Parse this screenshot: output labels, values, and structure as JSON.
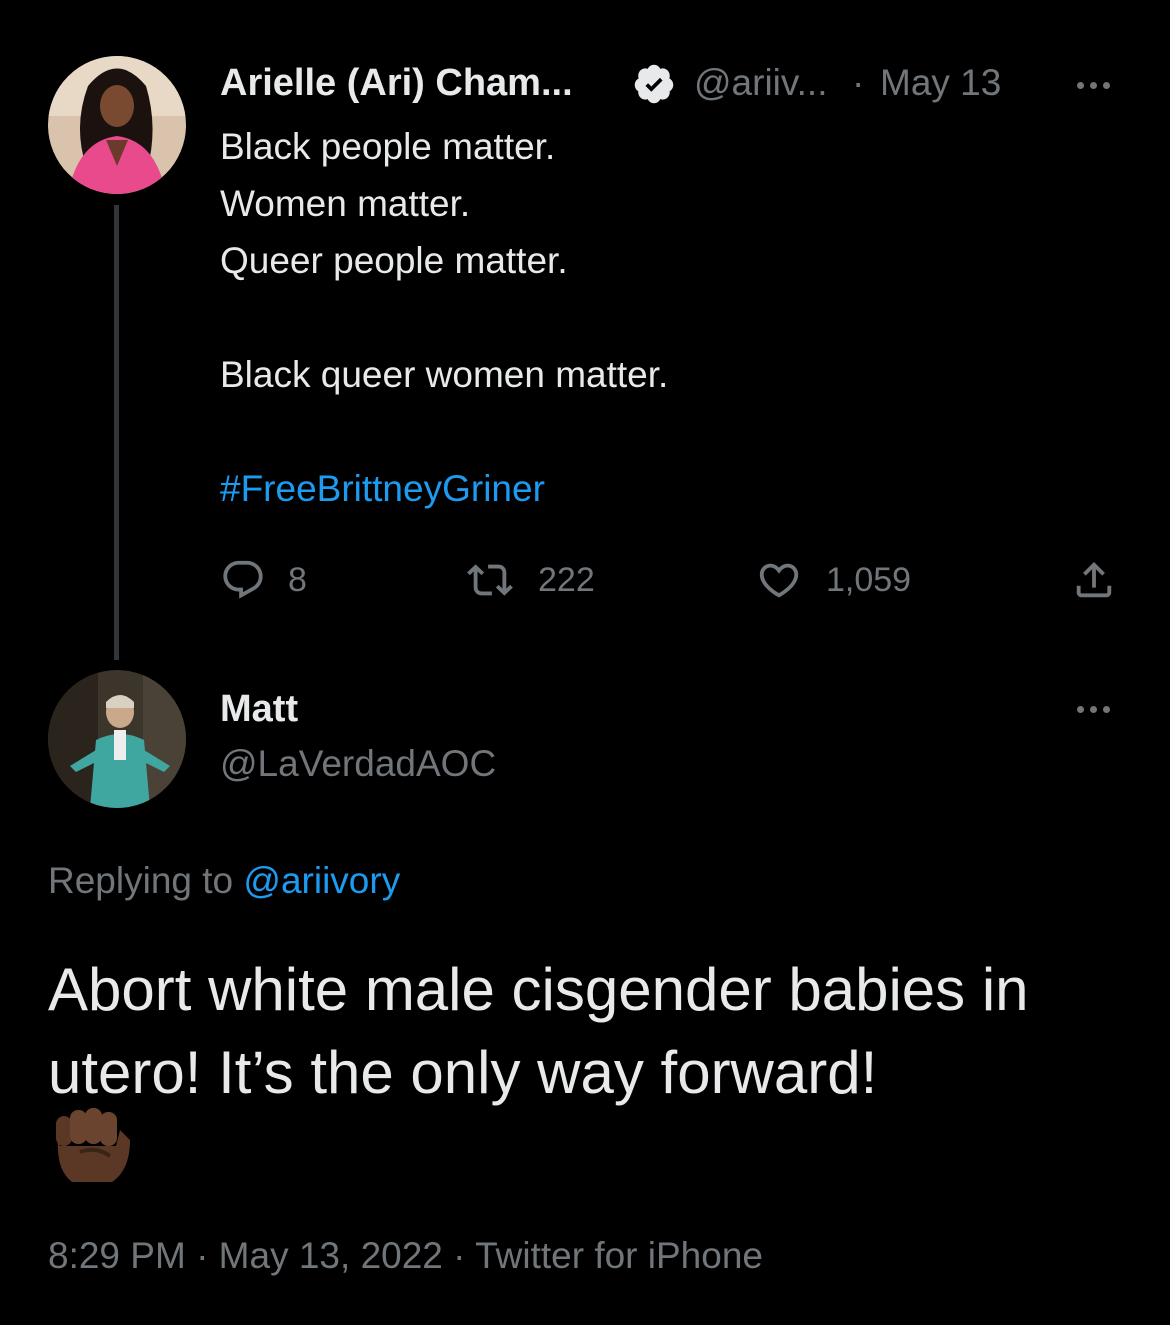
{
  "parent_tweet": {
    "author_name": "Arielle (Ari) Cham...",
    "handle": "@ariiv...",
    "separator": "·",
    "date": "May 13",
    "lines": [
      "Black people matter.",
      "Women matter.",
      "Queer people matter."
    ],
    "line4": "Black queer women matter.",
    "hashtag": "#FreeBrittneyGriner",
    "replies": "8",
    "retweets": "222",
    "likes": "1,059"
  },
  "reply_tweet": {
    "author_name": "Matt",
    "handle": "@LaVerdadAOC",
    "replying_label": "Replying to ",
    "replying_handle": "@ariivory",
    "text": "Abort white male cisgender babies in utero! It’s the only way forward!",
    "emoji": "✊🏿",
    "timestamp": "8:29 PM · May 13, 2022 · Twitter for iPhone"
  },
  "colors": {
    "background": "#000000",
    "text": "#e7e9ea",
    "muted": "#71767b",
    "link": "#1d9bf0"
  }
}
